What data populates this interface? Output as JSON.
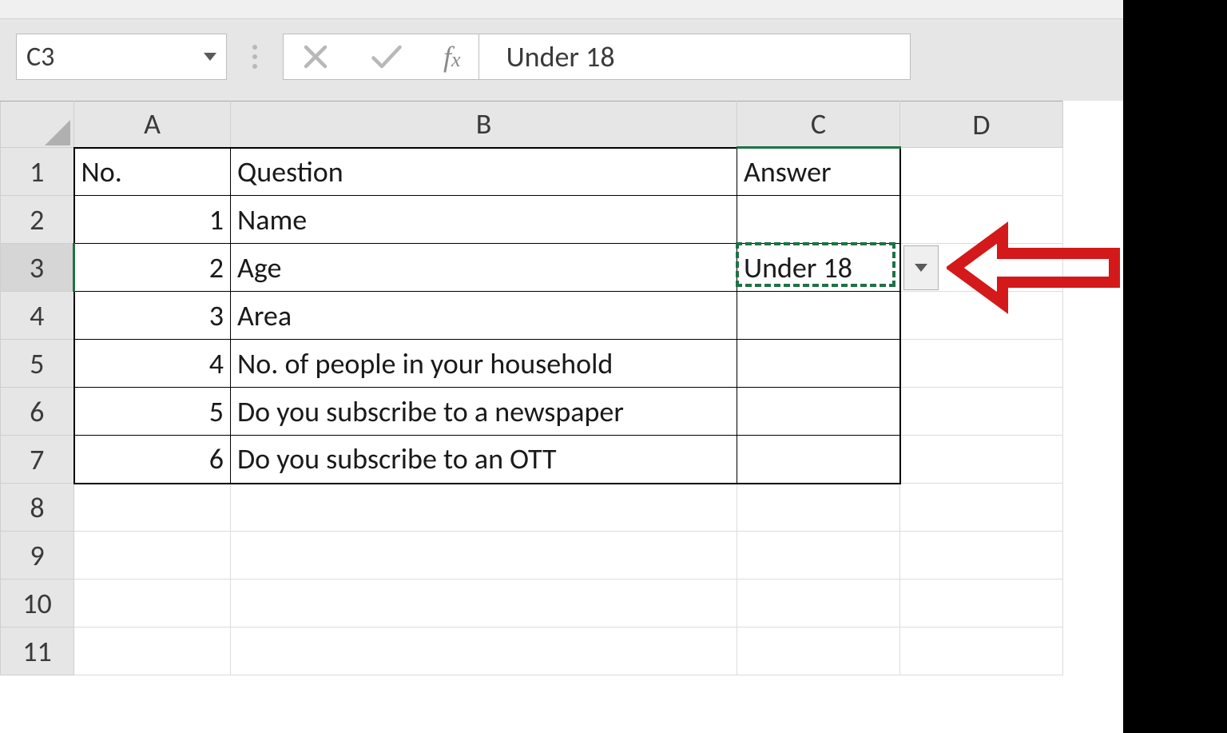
{
  "name_box": "C3",
  "formula_value": "Under 18",
  "columns": [
    "A",
    "B",
    "C",
    "D"
  ],
  "rows": [
    "1",
    "2",
    "3",
    "4",
    "5",
    "6",
    "7",
    "8",
    "9",
    "10",
    "11"
  ],
  "selected_cell": "C3",
  "table": {
    "headers": {
      "no": "No.",
      "question": "Question",
      "answer": "Answer"
    },
    "rows": [
      {
        "no": "1",
        "question": "Name",
        "answer": ""
      },
      {
        "no": "2",
        "question": "Age",
        "answer": "Under 18"
      },
      {
        "no": "3",
        "question": "Area",
        "answer": ""
      },
      {
        "no": "4",
        "question": "No. of people in your household",
        "answer": ""
      },
      {
        "no": "5",
        "question": "Do you subscribe to a newspaper",
        "answer": ""
      },
      {
        "no": "6",
        "question": "Do you subscribe to an OTT",
        "answer": ""
      }
    ]
  },
  "icons": {
    "cancel": "×",
    "accept": "✓"
  }
}
